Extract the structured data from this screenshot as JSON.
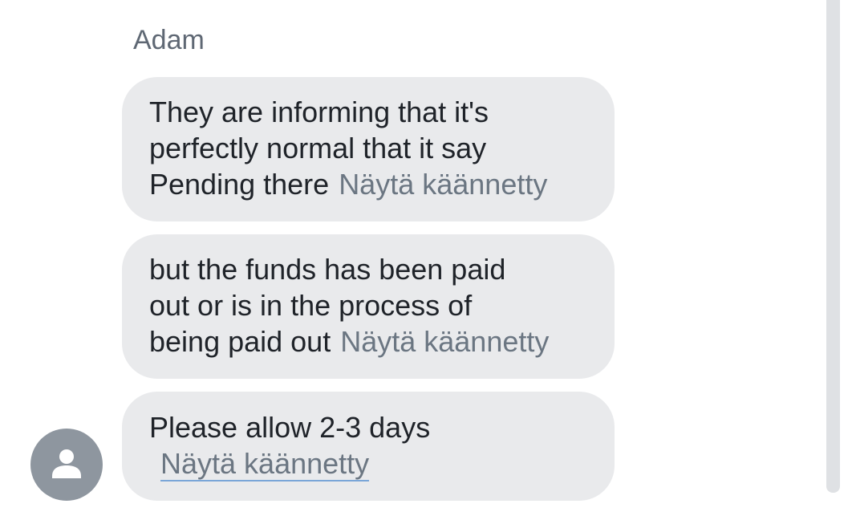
{
  "conversation": {
    "sender_name": "Adam",
    "translate_label": "Näytä käännetty",
    "messages": [
      {
        "lines": [
          "They are informing that it's",
          "perfectly normal that it say",
          "Pending there"
        ]
      },
      {
        "lines": [
          "but the funds has been paid",
          "out or is in the process of",
          "being paid out"
        ]
      },
      {
        "lines": [
          "Please allow 2-3 days"
        ]
      }
    ]
  },
  "avatar": {
    "icon": "person-icon"
  },
  "colors": {
    "bubble_bg": "#e9eaec",
    "text": "#1f2329",
    "muted": "#6b7682",
    "avatar_bg": "#8e969f",
    "link_underline": "#7aa6d8"
  }
}
